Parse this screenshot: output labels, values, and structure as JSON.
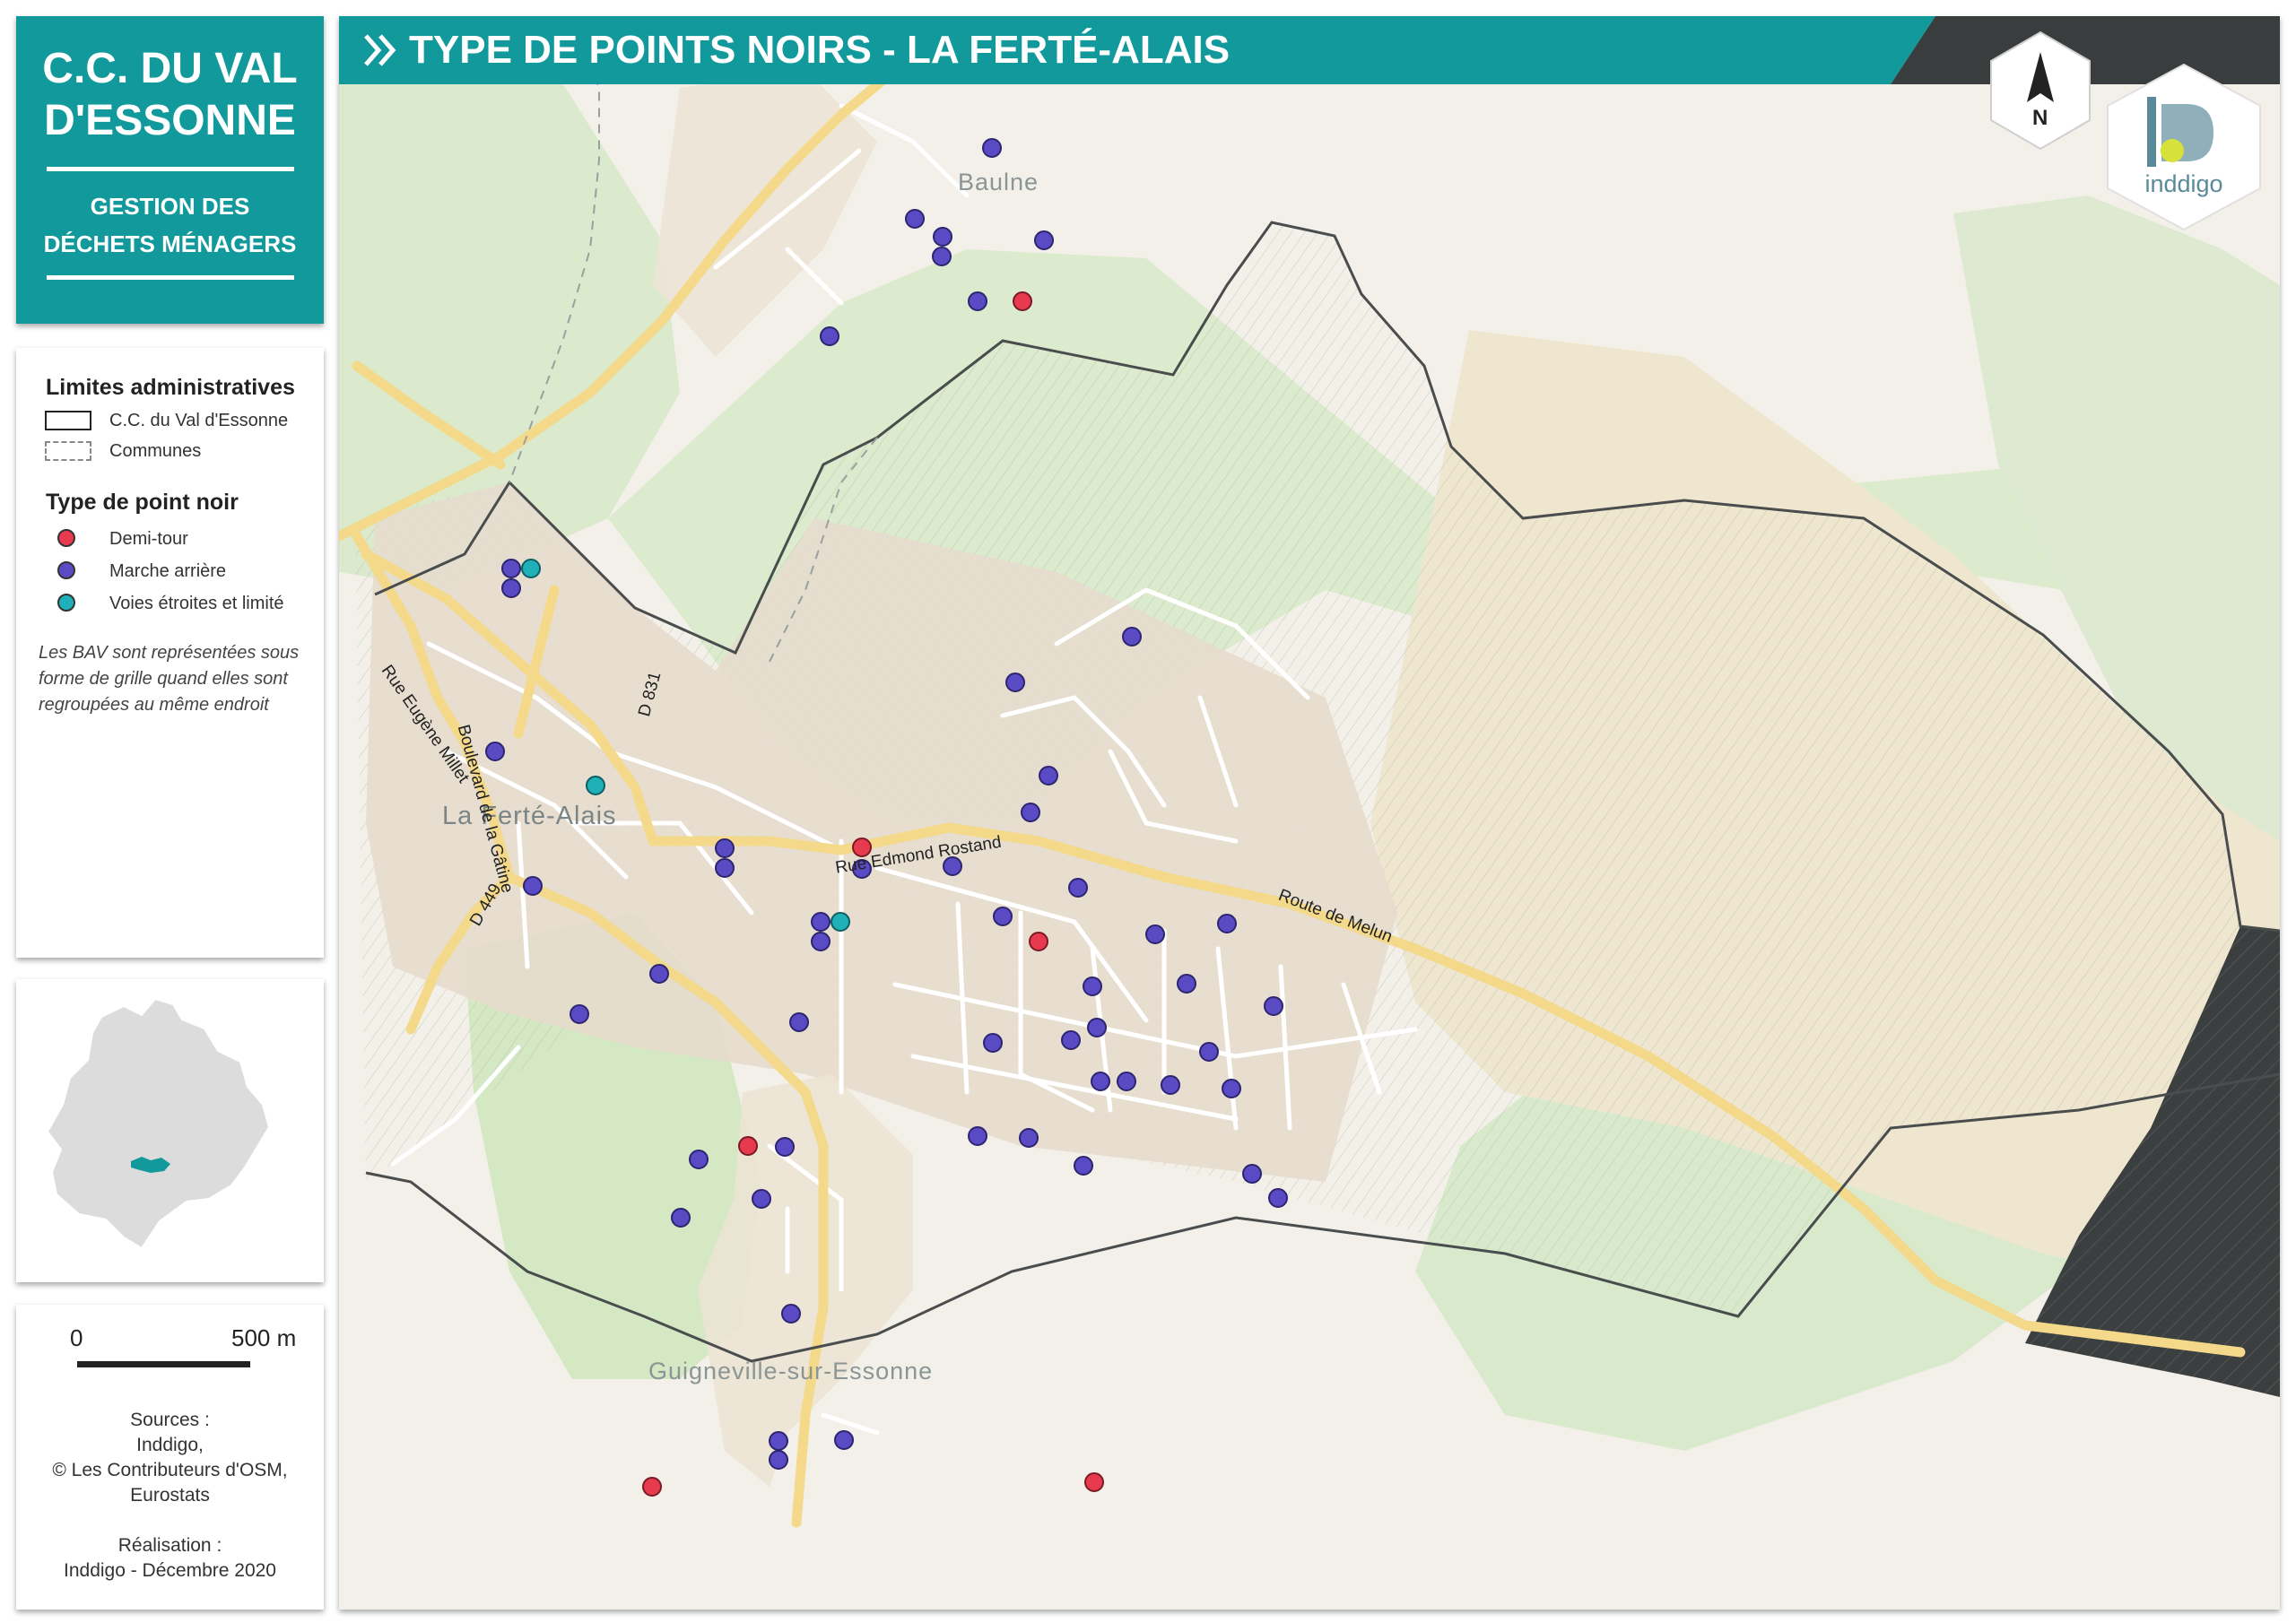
{
  "title_card": {
    "org_line1": "C.C. DU VAL",
    "org_line2": "D'ESSONNE",
    "subtitle_line1": "GESTION DES",
    "subtitle_line2": "DÉCHETS MÉNAGERS"
  },
  "banner": {
    "title": "TYPE DE POINTS NOIRS - LA FERTÉ-ALAIS",
    "icon": "double-chevron-right-icon"
  },
  "north_arrow": {
    "label": "N"
  },
  "logo": {
    "text": "inddigo"
  },
  "legend": {
    "admin_heading": "Limites administratives",
    "admin_items": [
      {
        "label": "C.C. du Val d'Essonne",
        "style": "solid"
      },
      {
        "label": "Communes",
        "style": "dashed"
      }
    ],
    "type_heading": "Type de point noir",
    "type_items": [
      {
        "label": "Demi-tour",
        "color": "#e83a4f"
      },
      {
        "label": "Marche arrière",
        "color": "#5a4bc4"
      },
      {
        "label": "Voies étroites et limité",
        "color": "#1fb0b8"
      }
    ],
    "note": "Les BAV sont représentées sous forme de grille quand elles sont regroupées au même endroit"
  },
  "scale": {
    "left": "0",
    "right": "500 m"
  },
  "sources": {
    "line1": "Sources :",
    "line2": "Inddigo,",
    "line3": "© Les Contributeurs d'OSM,",
    "line4": "Eurostats",
    "line5": "Réalisation :",
    "line6": "Inddigo - Décembre 2020"
  },
  "map": {
    "places": {
      "baulne": "Baulne",
      "ferte": "La Ferté-Alais",
      "guigneville": "Guigneville-sur-Essonne"
    },
    "roads": {
      "eugene_millet": "Rue Eugène Millet",
      "boulevard": "Boulevard de la Gâtine",
      "d831": "D 831",
      "d449": "D 449",
      "edmond_rostand": "Rue Edmond Rostand",
      "route_melun": "Route de Melun"
    }
  }
}
